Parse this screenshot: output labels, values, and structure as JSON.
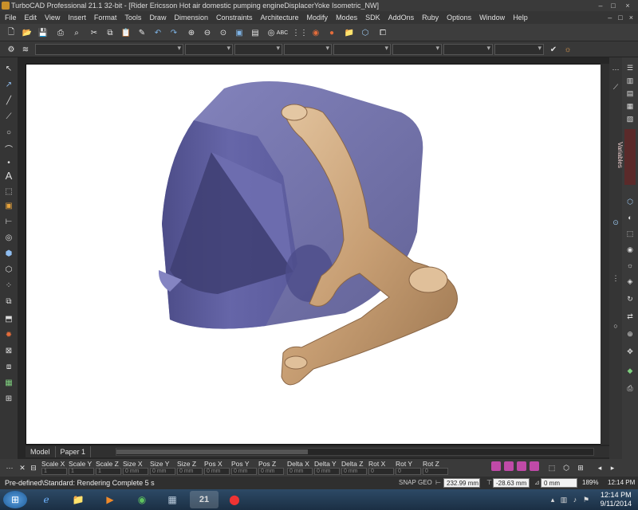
{
  "window": {
    "title": "TurboCAD Professional 21.1 32-bit - [Rider Ericsson Hot air domestic pumping engineDisplacerYoke Isometric_NW]",
    "controls": [
      "–",
      "□",
      "×"
    ]
  },
  "menubar": {
    "items": [
      "File",
      "Edit",
      "View",
      "Insert",
      "Format",
      "Tools",
      "Draw",
      "Dimension",
      "Constraints",
      "Architecture",
      "Modify",
      "Modes",
      "SDK",
      "AddOns",
      "Ruby",
      "Options",
      "Window",
      "Help"
    ],
    "controls": [
      "–",
      "□",
      "×"
    ]
  },
  "toolbar": {
    "icons": [
      "new-file-icon",
      "open-folder-icon",
      "save-icon",
      "print-icon",
      "print-preview-icon",
      "cut-icon",
      "copy-icon",
      "paste-icon",
      "undo-icon",
      "redo-icon",
      "zoom-window-icon",
      "zoom-out-icon",
      "zoom-extents-icon",
      "render-icon",
      "abc-icon",
      "grid-icon",
      "snap-icon",
      "record-icon",
      "library-icon",
      "cube-icon"
    ]
  },
  "tabs": {
    "model_label": "Model",
    "paper_label": "Paper 1"
  },
  "sidepanel": {
    "variables_label": "Variables"
  },
  "inspector": {
    "fields": [
      {
        "label": "Scale X",
        "value": "1"
      },
      {
        "label": "Scale Y",
        "value": "1"
      },
      {
        "label": "Scale Z",
        "value": "1"
      },
      {
        "label": "Size X",
        "value": "0 mm"
      },
      {
        "label": "Size Y",
        "value": "0 mm"
      },
      {
        "label": "Size Z",
        "value": "0 mm"
      },
      {
        "label": "Pos X",
        "value": "0 mm"
      },
      {
        "label": "Pos Y",
        "value": "0 mm"
      },
      {
        "label": "Pos Z",
        "value": "0 mm"
      },
      {
        "label": "Delta X",
        "value": "0 mm"
      },
      {
        "label": "Delta Y",
        "value": "0 mm"
      },
      {
        "label": "Delta Z",
        "value": "0 mm"
      },
      {
        "label": "Rot X",
        "value": "0"
      },
      {
        "label": "Rot Y",
        "value": "0"
      },
      {
        "label": "Rot Z",
        "value": "0"
      }
    ]
  },
  "status": {
    "message": "Pre-defined\\Standard: Rendering Complete 5 s",
    "snap_label": "SNAP",
    "geo_label": "GEO",
    "x_value": "232.99 mm",
    "y_value": "-28.63 mm",
    "z_value": "0 mm",
    "zoom_value": "189%",
    "time_value": "12:14 PM"
  },
  "taskbar": {
    "time": "12:14 PM",
    "date": "9/11/2014"
  },
  "colors": {
    "cylinder": "#5a5a9e",
    "yoke": "#c9a37b",
    "canvas": "#ffffff",
    "chrome": "#353535"
  }
}
